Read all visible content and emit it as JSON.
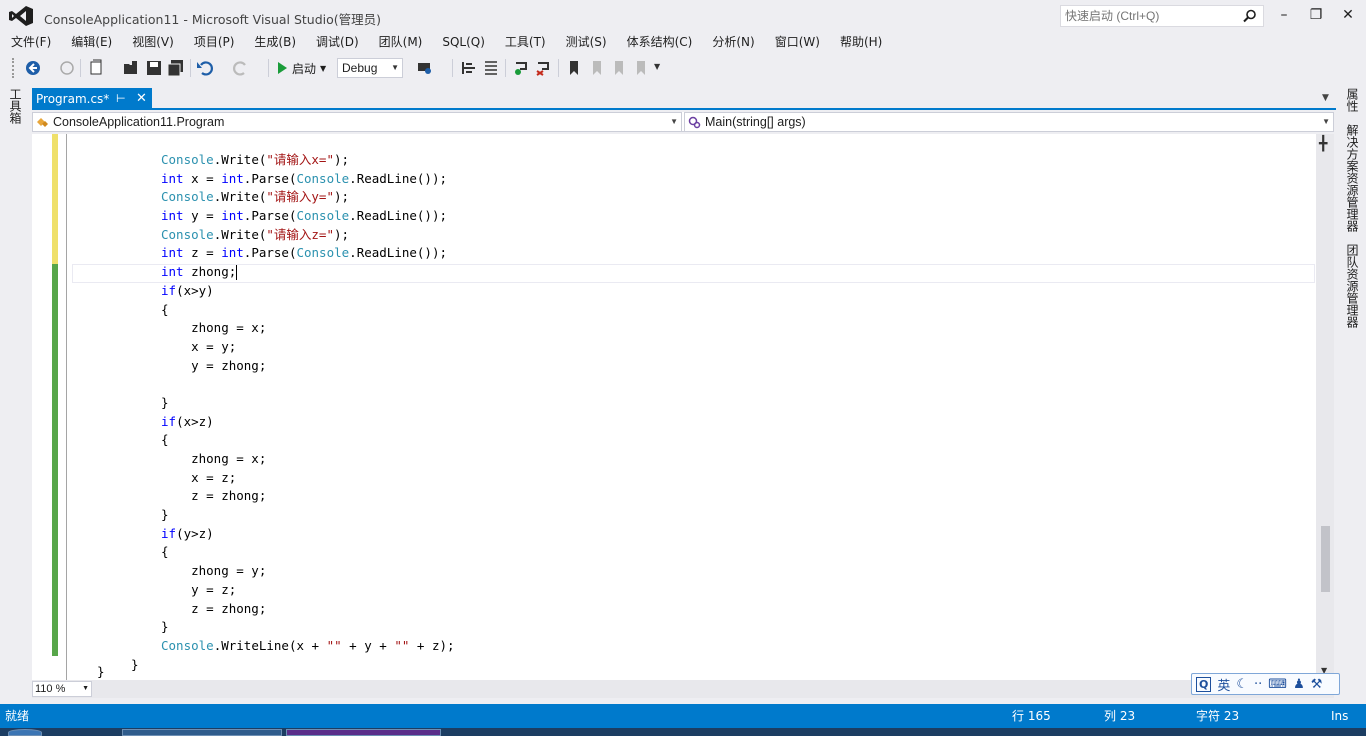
{
  "window": {
    "title": "ConsoleApplication11 - Microsoft Visual Studio(管理员)",
    "quick_launch_placeholder": "快速启动 (Ctrl+Q)"
  },
  "menu": [
    "文件(F)",
    "编辑(E)",
    "视图(V)",
    "项目(P)",
    "生成(B)",
    "调试(D)",
    "团队(M)",
    "SQL(Q)",
    "工具(T)",
    "测试(S)",
    "体系结构(C)",
    "分析(N)",
    "窗口(W)",
    "帮助(H)"
  ],
  "toolbar": {
    "start_label": "启动",
    "configuration": "Debug"
  },
  "side_panels": {
    "left": "工具箱",
    "right": [
      "属性",
      "解决方案资源管理器",
      "团队资源管理器"
    ]
  },
  "document_tab": {
    "label": "Program.cs*"
  },
  "navigation": {
    "type": "ConsoleApplication11.Program",
    "member": "Main(string[] args)"
  },
  "code_lines": [
    [
      {
        "t": "Console",
        "c": "ty"
      },
      {
        "t": ".Write("
      },
      {
        "t": "\"请输入x=\"",
        "c": "st"
      },
      {
        "t": ");"
      }
    ],
    [
      {
        "t": "int",
        "c": "kw"
      },
      {
        "t": " x = "
      },
      {
        "t": "int",
        "c": "kw"
      },
      {
        "t": ".Parse("
      },
      {
        "t": "Console",
        "c": "ty"
      },
      {
        "t": ".ReadLine());"
      }
    ],
    [
      {
        "t": "Console",
        "c": "ty"
      },
      {
        "t": ".Write("
      },
      {
        "t": "\"请输入y=\"",
        "c": "st"
      },
      {
        "t": ");"
      }
    ],
    [
      {
        "t": "int",
        "c": "kw"
      },
      {
        "t": " y = "
      },
      {
        "t": "int",
        "c": "kw"
      },
      {
        "t": ".Parse("
      },
      {
        "t": "Console",
        "c": "ty"
      },
      {
        "t": ".ReadLine());"
      }
    ],
    [
      {
        "t": "Console",
        "c": "ty"
      },
      {
        "t": ".Write("
      },
      {
        "t": "\"请输入z=\"",
        "c": "st"
      },
      {
        "t": ");"
      }
    ],
    [
      {
        "t": "int",
        "c": "kw"
      },
      {
        "t": " z = "
      },
      {
        "t": "int",
        "c": "kw"
      },
      {
        "t": ".Parse("
      },
      {
        "t": "Console",
        "c": "ty"
      },
      {
        "t": ".ReadLine());"
      }
    ],
    [
      {
        "t": "int",
        "c": "kw"
      },
      {
        "t": " zhong;"
      },
      {
        "caret": true
      }
    ],
    [
      {
        "t": "if",
        "c": "kw"
      },
      {
        "t": "(x>y)"
      }
    ],
    [
      {
        "t": "{"
      }
    ],
    [
      {
        "t": "    zhong = x;"
      }
    ],
    [
      {
        "t": "    x = y;"
      }
    ],
    [
      {
        "t": "    y = zhong;"
      }
    ],
    [
      {
        "t": ""
      }
    ],
    [
      {
        "t": "}"
      }
    ],
    [
      {
        "t": "if",
        "c": "kw"
      },
      {
        "t": "(x>z)"
      }
    ],
    [
      {
        "t": "{"
      }
    ],
    [
      {
        "t": "    zhong = x;"
      }
    ],
    [
      {
        "t": "    x = z;"
      }
    ],
    [
      {
        "t": "    z = zhong;"
      }
    ],
    [
      {
        "t": "}"
      }
    ],
    [
      {
        "t": "if",
        "c": "kw"
      },
      {
        "t": "(y>z)"
      }
    ],
    [
      {
        "t": "{"
      }
    ],
    [
      {
        "t": "    zhong = y;"
      }
    ],
    [
      {
        "t": "    y = z;"
      }
    ],
    [
      {
        "t": "    z = zhong;"
      }
    ],
    [
      {
        "t": "}"
      }
    ],
    [
      {
        "t": "Console",
        "c": "ty"
      },
      {
        "t": ".WriteLine(x + "
      },
      {
        "t": "\"\"",
        "c": "st"
      },
      {
        "t": " + y + "
      },
      {
        "t": "\"\"",
        "c": "st"
      },
      {
        "t": " + z);"
      }
    ],
    [
      {
        "t": "}",
        "dedent": true
      }
    ]
  ],
  "zoom": "110 %",
  "ime": "英",
  "status": {
    "message": "就绪",
    "line": "行 165",
    "col": "列 23",
    "char": "字符 23",
    "mode": "Ins"
  },
  "colors": {
    "accent": "#007acc",
    "keyword": "#0000ff",
    "type": "#2b91af",
    "string": "#a31515",
    "saved_change": "#57a64a",
    "unsaved_change": "#efe06a"
  }
}
